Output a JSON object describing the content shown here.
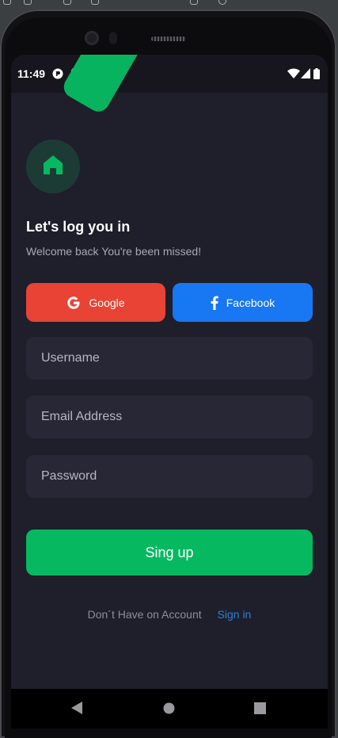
{
  "status_bar": {
    "time": "11:49"
  },
  "login": {
    "title": "Let's log you in",
    "subtitle": "Welcome back You're been missed!"
  },
  "social": {
    "google_label": "Google",
    "facebook_label": "Facebook"
  },
  "form": {
    "username_placeholder": "Username",
    "email_placeholder": "Email Address",
    "password_placeholder": "Password",
    "username_value": "",
    "email_value": "",
    "password_value": ""
  },
  "actions": {
    "signup_label": "Sing up",
    "account_prompt": "Don´t Have on Account",
    "signin_link": "Sign in"
  },
  "colors": {
    "background": "#1f1e2b",
    "accent_green": "#06b960",
    "google_red": "#e84335",
    "facebook_blue": "#1877f2",
    "field_bg": "#282735",
    "link_blue": "#2c7fd9"
  },
  "icons": {
    "logo": "home-icon",
    "google": "google-icon",
    "facebook": "facebook-icon",
    "status": [
      "status-app-icon",
      "sd-card-icon",
      "wifi-icon",
      "signal-icon",
      "battery-icon"
    ],
    "nav": [
      "back-icon",
      "home-nav-icon",
      "recents-icon"
    ]
  }
}
